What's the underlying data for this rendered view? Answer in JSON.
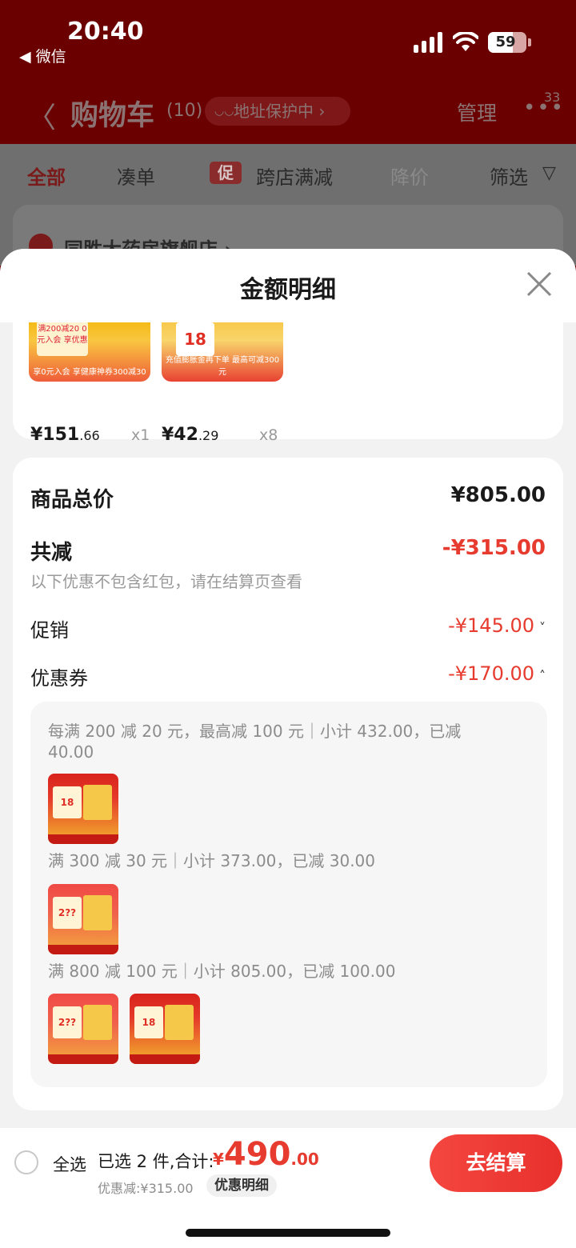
{
  "status_bar": {
    "time": "20:40",
    "back_app": "◀ 微信",
    "battery": "59"
  },
  "header": {
    "back": "〈",
    "title": "购物车",
    "count": "(10)",
    "address_pill": "地址保护中 ›",
    "manage": "管理",
    "more": "•••",
    "badge": "33"
  },
  "tabs": {
    "all": "全部",
    "bundle": "凑单",
    "promo_tag": "促",
    "cross_store": "跨店满减",
    "price_drop": "降价",
    "filter": "筛选"
  },
  "store": {
    "name": "同胜大药房旗舰店 ›"
  },
  "sheet": {
    "title": "金额明细",
    "products": [
      {
        "price_int": "¥151",
        "price_dec": ".66",
        "qty": "x1",
        "thumb_label": "享0元入会 享健康神券300减30",
        "thumb_box": "满200减20 0元入会 享优惠"
      },
      {
        "price_int": "¥42",
        "price_dec": ".29",
        "qty": "x8",
        "thumb_label": "充值膨胀金再下单 最高可减300元",
        "thumb_box": "18"
      }
    ],
    "summary": {
      "total_label": "商品总价",
      "total_value": "¥805.00",
      "reduce_label": "共减",
      "reduce_value": "-¥315.00",
      "note": "以下优惠不包含红包，请在结算页查看",
      "promo_label": "促销",
      "promo_value": "-¥145.00",
      "coupon_label": "优惠券",
      "coupon_value": "-¥170.00"
    },
    "coupons": [
      {
        "rule": "每满 200 减 20 元，最高减 100 元｜小计 432.00，已减 40.00"
      },
      {
        "rule": "满 300 减 30 元｜小计 373.00，已减 30.00"
      },
      {
        "rule": "满 800 减 100 元｜小计 805.00，已减 100.00"
      }
    ]
  },
  "bottom": {
    "select_all": "全选",
    "selected_info": "已选 2 件,合计:",
    "currency": "¥",
    "total_int": "490",
    "total_dec": ".00",
    "saved": "优惠减:¥315.00",
    "detail": "优惠明细",
    "checkout": "去结算"
  },
  "colors": {
    "accent": "#e63b2e",
    "header_bg": "#6b0000"
  }
}
